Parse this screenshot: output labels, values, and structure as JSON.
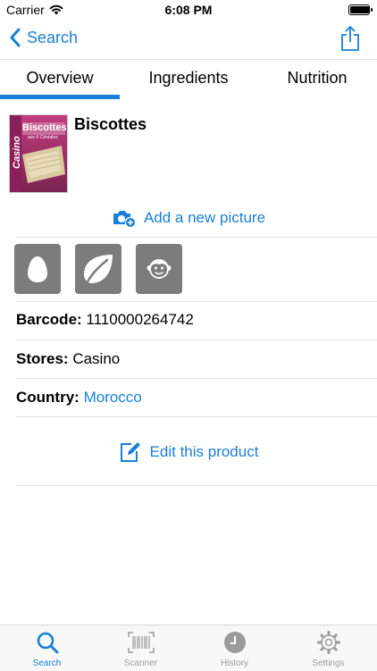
{
  "status_bar": {
    "carrier": "Carrier",
    "time": "6:08 PM",
    "battery_level": 0.95
  },
  "nav": {
    "back_label": "Search",
    "share_icon": "share-icon"
  },
  "tabs": [
    {
      "label": "Overview",
      "selected": true
    },
    {
      "label": "Ingredients",
      "selected": false
    },
    {
      "label": "Nutrition",
      "selected": false
    }
  ],
  "product": {
    "name": "Biscottes",
    "image_text": {
      "brand": "Casino",
      "title": "Biscottes",
      "subtitle": "aux 6 Céréales"
    },
    "add_picture_label": "Add a new picture",
    "badges": [
      "egg-icon",
      "leaf-icon",
      "monkey-icon"
    ],
    "barcode": {
      "label": "Barcode:",
      "value": "1110000264742"
    },
    "stores": {
      "label": "Stores:",
      "value": "Casino"
    },
    "country": {
      "label": "Country:",
      "value": "Morocco"
    },
    "edit_label": "Edit this product"
  },
  "tab_bar": {
    "items": [
      {
        "label": "Search",
        "icon": "search-icon",
        "active": true
      },
      {
        "label": "Scanner",
        "icon": "barcode-scanner-icon",
        "active": false
      },
      {
        "label": "History",
        "icon": "clock-icon",
        "active": false
      },
      {
        "label": "Settings",
        "icon": "gear-icon",
        "active": false
      }
    ]
  },
  "colors": {
    "accent": "#1a7fd6",
    "badge_gray": "#7c7c7c",
    "inactive_tab": "#9b9b9b"
  }
}
